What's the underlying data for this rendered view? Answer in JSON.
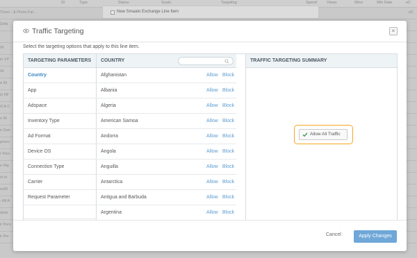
{
  "background": {
    "columns": [
      "ID",
      "Type",
      "Status",
      "Seats",
      "Targeting",
      "Spend",
      "Views",
      "Wins",
      "Win Rate",
      "eC"
    ],
    "tooltip_text": "New Smaato Exchange Line Item",
    "left_fragments": [
      "Thom - & Photo Fal...",
      "Defa",
      "",
      "IN",
      "in VP",
      "IN",
      "e IN",
      "in NF",
      "ICA C",
      "s IN",
      "e Gas",
      "prioro",
      "r Pers",
      "e Hig",
      "In in",
      "estD",
      "- All A",
      "iacte",
      "ir Pers",
      "ir Per",
      ""
    ],
    "right_fragments": [
      "eC",
      "",
      "",
      "",
      "",
      "",
      "",
      "",
      "",
      "",
      "",
      "",
      "",
      "",
      "",
      "",
      "",
      "",
      "",
      "",
      ""
    ]
  },
  "modal": {
    "title": "Traffic Targeting",
    "subtitle": "Select the targeting options that apply to this line item.",
    "close_label": "×",
    "params_header": "TARGETING PARAMETERS",
    "params": [
      "Country",
      "App",
      "Adspace",
      "Inventory Type",
      "Ad Format",
      "Device OS",
      "Connection Type",
      "Carrier",
      "Request Parameter",
      ""
    ],
    "country_header": "COUNTRY",
    "search_placeholder": "",
    "allow_label": "Allow",
    "block_label": "Block",
    "countries": [
      "Afghanistan",
      "Albania",
      "Algeria",
      "American Samoa",
      "Andorra",
      "Angola",
      "Anguilla",
      "Antarctica",
      "Antigua and Barbuda",
      "Argentina"
    ],
    "summary_header": "TRAFFIC TARGETING SUMMARY",
    "allow_all_label": "Allow All Traffic",
    "cancel_label": "Cancel",
    "apply_label": "Apply Changes"
  },
  "colors": {
    "accent": "#3a87c4",
    "link": "#5b9bd1",
    "highlight": "#f5a623",
    "apply_button": "#6fa7d8",
    "check": "#3a9a4a"
  }
}
